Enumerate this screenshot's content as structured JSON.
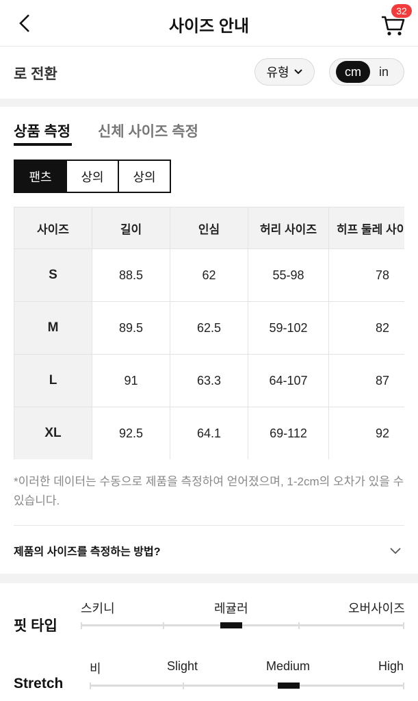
{
  "header": {
    "title": "사이즈 안내",
    "cart_count": "32"
  },
  "unit_row": {
    "label": "로 전환",
    "type_dropdown": "유형",
    "units": [
      "cm",
      "in"
    ],
    "selected_unit": "cm"
  },
  "tabs": [
    {
      "label": "상품 측정",
      "active": true
    },
    {
      "label": "신체 사이즈 측정",
      "active": false
    }
  ],
  "categories": [
    {
      "label": "팬츠",
      "active": true
    },
    {
      "label": "상의",
      "active": false
    },
    {
      "label": "상의",
      "active": false
    }
  ],
  "size_table": {
    "headers": [
      "사이즈",
      "길이",
      "인심",
      "허리 사이즈",
      "히프 둘레 사이"
    ],
    "rows": [
      [
        "S",
        "88.5",
        "62",
        "55-98",
        "78"
      ],
      [
        "M",
        "89.5",
        "62.5",
        "59-102",
        "82"
      ],
      [
        "L",
        "91",
        "63.3",
        "64-107",
        "87"
      ],
      [
        "XL",
        "92.5",
        "64.1",
        "69-112",
        "92"
      ]
    ]
  },
  "note": "*이러한 데이터는 수동으로 제품을 측정하여 얻어졌으며, 1-2cm의 오차가 있을 수 있습니다.",
  "howto": "제품의 사이즈를 측정하는 방법?",
  "fit": {
    "title": "핏 타입",
    "labels": [
      "스키니",
      "레귤러",
      "오버사이즈"
    ],
    "selected": "레귤러"
  },
  "stretch": {
    "title": "Stretch",
    "labels": [
      "비",
      "Slight",
      "Medium",
      "High"
    ],
    "selected": "Medium"
  },
  "colors": {
    "accent_dark": "#111111",
    "badge_red": "#f23b3b",
    "muted_text": "#888888"
  }
}
